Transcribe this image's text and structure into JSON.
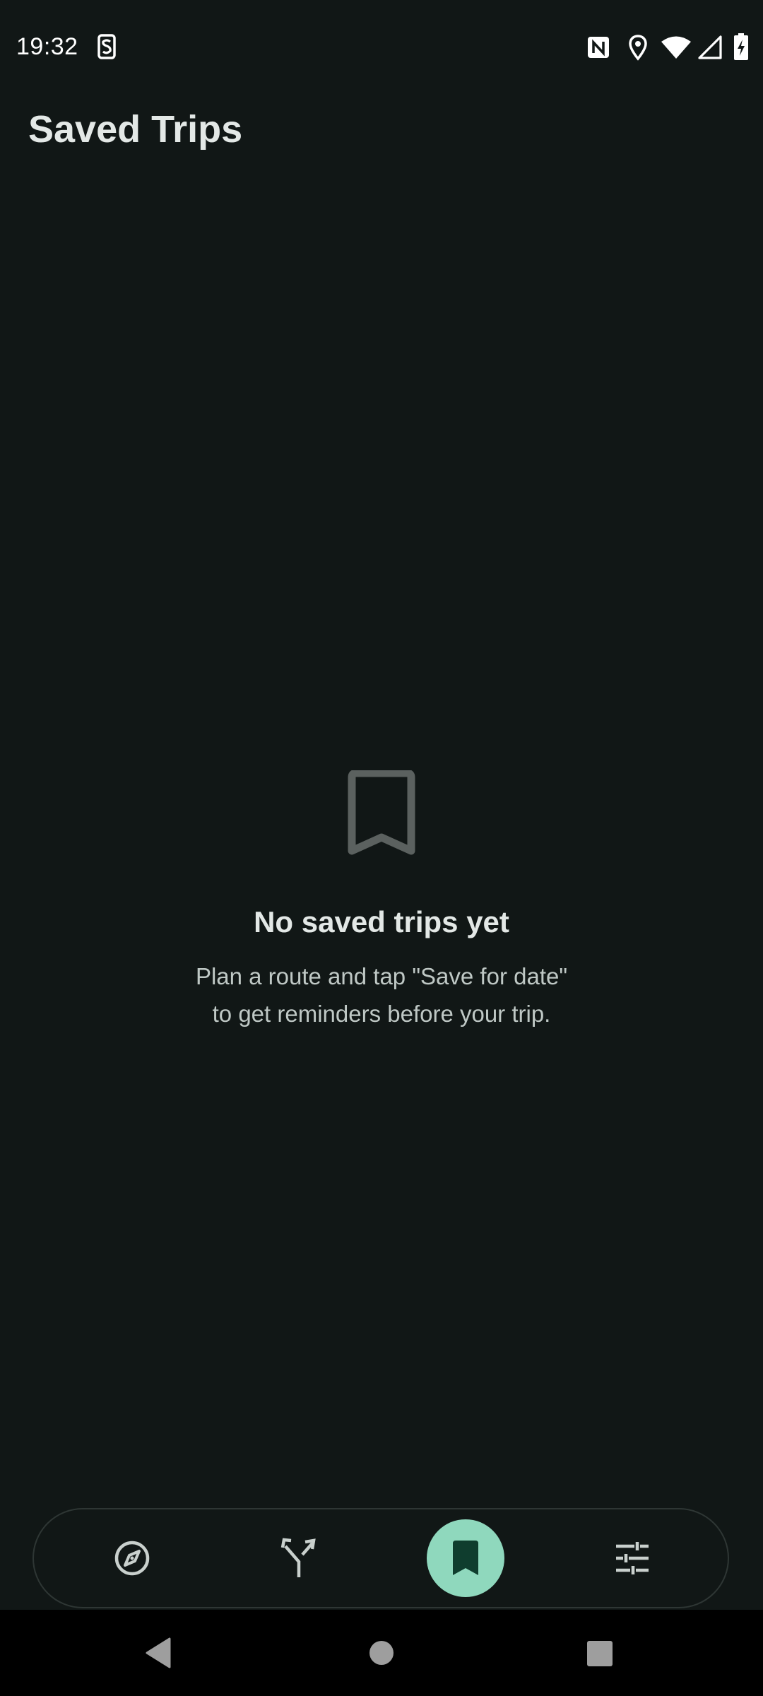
{
  "status_bar": {
    "time": "19:32",
    "icons": [
      "sim-toolkit-icon",
      "nfc-icon",
      "location-icon",
      "wifi-icon",
      "cell-signal-icon",
      "battery-charging-icon"
    ]
  },
  "header": {
    "title": "Saved Trips"
  },
  "empty_state": {
    "icon": "bookmark-outline-icon",
    "title": "No saved trips yet",
    "subtitle_line1": "Plan a route and tap \"Save for date\"",
    "subtitle_line2": "to get reminders before your trip."
  },
  "bottom_nav": {
    "items": [
      {
        "icon": "compass-icon",
        "active": false
      },
      {
        "icon": "route-fork-icon",
        "active": false
      },
      {
        "icon": "bookmark-icon",
        "active": true
      },
      {
        "icon": "tune-icon",
        "active": false
      }
    ],
    "active_color": "#8fd8bd"
  },
  "system_nav": {
    "buttons": [
      "back-icon",
      "home-icon",
      "recents-icon"
    ]
  },
  "colors": {
    "background": "#111716",
    "text_primary": "#e3e8e6",
    "text_secondary": "#bfc8c5",
    "accent": "#8fd8bd",
    "icon_muted": "#5b615f"
  }
}
